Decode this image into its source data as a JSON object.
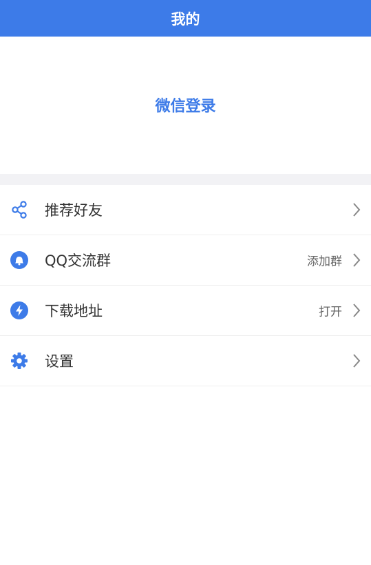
{
  "header": {
    "title": "我的"
  },
  "login": {
    "label": "微信登录"
  },
  "menu": {
    "items": [
      {
        "label": "推荐好友",
        "extra": "",
        "icon": "share-icon"
      },
      {
        "label": "QQ交流群",
        "extra": "添加群",
        "icon": "qq-bell-icon"
      },
      {
        "label": "下载地址",
        "extra": "打开",
        "icon": "lightning-icon"
      },
      {
        "label": "设置",
        "extra": "",
        "icon": "gear-icon"
      }
    ]
  },
  "colors": {
    "accent": "#3d7be8",
    "background": "#ffffff",
    "divider": "#f2f2f5"
  }
}
